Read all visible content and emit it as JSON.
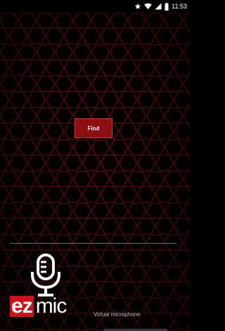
{
  "status_bar": {
    "time": "11:53",
    "icons": [
      "star-icon",
      "wifi-icon",
      "signal-icon",
      "battery-icon"
    ]
  },
  "find_button": {
    "label": "Find"
  },
  "logo": {
    "part1": "ez",
    "part2": "mic"
  },
  "tagline": "Virtual microphone",
  "colors": {
    "background": "#050000",
    "hex_outline": "#5a0d0d",
    "button": "#8c0f12",
    "logo_red": "#c4151b",
    "text_gray": "#b9b9b9"
  }
}
